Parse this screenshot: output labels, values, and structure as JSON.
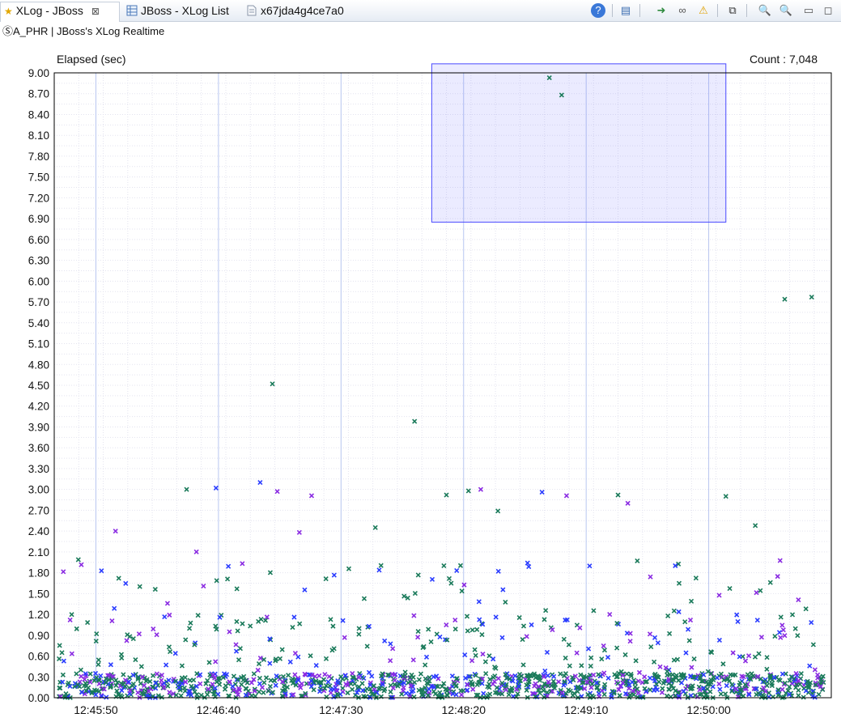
{
  "tabs": [
    {
      "label": "XLog - JBoss",
      "active": true
    },
    {
      "label": "JBoss - XLog List",
      "active": false
    },
    {
      "label": "x67jda4g4ce7a0",
      "active": false
    }
  ],
  "toolbar": {
    "icons": [
      "help-icon",
      "counter-icon",
      "export-icon",
      "link-icon",
      "warning-icon",
      "filter-icon",
      "zoom-in-icon",
      "zoom-out-icon",
      "minimize-icon",
      "maximize-icon"
    ]
  },
  "subtitle": "ⓈA_PHR | JBoss's XLog Realtime",
  "chart_data": {
    "type": "scatter",
    "ylabel": "Elapsed (sec)",
    "count_label": "Count : 7,048",
    "ylim": [
      0,
      9
    ],
    "yticks": [
      "0.00",
      "0.30",
      "0.60",
      "0.90",
      "1.20",
      "1.50",
      "1.80",
      "2.10",
      "2.40",
      "2.70",
      "3.00",
      "3.30",
      "3.60",
      "3.90",
      "4.20",
      "4.50",
      "4.80",
      "5.10",
      "5.40",
      "5.70",
      "6.00",
      "6.30",
      "6.60",
      "6.90",
      "7.20",
      "7.50",
      "7.80",
      "8.10",
      "8.40",
      "8.70",
      "9.00"
    ],
    "xticks": [
      "12:45:50",
      "12:46:40",
      "12:47:30",
      "12:48:20",
      "12:49:10",
      "12:50:00"
    ],
    "xrange_seconds_after_12_45_50": [
      -17,
      300
    ],
    "grid": true,
    "selection": {
      "x_start": "12:48:07",
      "x_end": "12:50:07",
      "y_start": 6.85,
      "y_end": 9.13
    },
    "series_colors": {
      "green": "#1a7a5a",
      "purple": "#8a2be2",
      "blue": "#2a3cff"
    },
    "outliers": [
      {
        "t": "12:48:55",
        "y": 8.93,
        "c": "green"
      },
      {
        "t": "12:49:00",
        "y": 8.68,
        "c": "green"
      },
      {
        "t": "12:47:02",
        "y": 4.52,
        "c": "green"
      },
      {
        "t": "12:48:00",
        "y": 3.98,
        "c": "green"
      },
      {
        "t": "12:50:31",
        "y": 5.74,
        "c": "green"
      },
      {
        "t": "12:50:42",
        "y": 5.77,
        "c": "green"
      },
      {
        "t": "12:46:27",
        "y": 3.0,
        "c": "green"
      },
      {
        "t": "12:46:39",
        "y": 3.02,
        "c": "blue"
      },
      {
        "t": "12:46:57",
        "y": 3.1,
        "c": "blue"
      },
      {
        "t": "12:47:04",
        "y": 2.97,
        "c": "purple"
      },
      {
        "t": "12:47:18",
        "y": 2.91,
        "c": "purple"
      },
      {
        "t": "12:48:13",
        "y": 2.92,
        "c": "green"
      },
      {
        "t": "12:48:22",
        "y": 2.98,
        "c": "green"
      },
      {
        "t": "12:48:27",
        "y": 3.0,
        "c": "purple"
      },
      {
        "t": "12:48:34",
        "y": 2.69,
        "c": "green"
      },
      {
        "t": "12:48:52",
        "y": 2.96,
        "c": "blue"
      },
      {
        "t": "12:49:02",
        "y": 2.91,
        "c": "purple"
      },
      {
        "t": "12:49:23",
        "y": 2.92,
        "c": "green"
      },
      {
        "t": "12:49:27",
        "y": 2.8,
        "c": "purple"
      },
      {
        "t": "12:50:07",
        "y": 2.9,
        "c": "green"
      },
      {
        "t": "12:50:19",
        "y": 2.48,
        "c": "green"
      },
      {
        "t": "12:45:58",
        "y": 2.4,
        "c": "purple"
      },
      {
        "t": "12:46:31",
        "y": 2.1,
        "c": "purple"
      },
      {
        "t": "12:47:13",
        "y": 2.38,
        "c": "purple"
      },
      {
        "t": "12:47:44",
        "y": 2.45,
        "c": "green"
      }
    ]
  }
}
